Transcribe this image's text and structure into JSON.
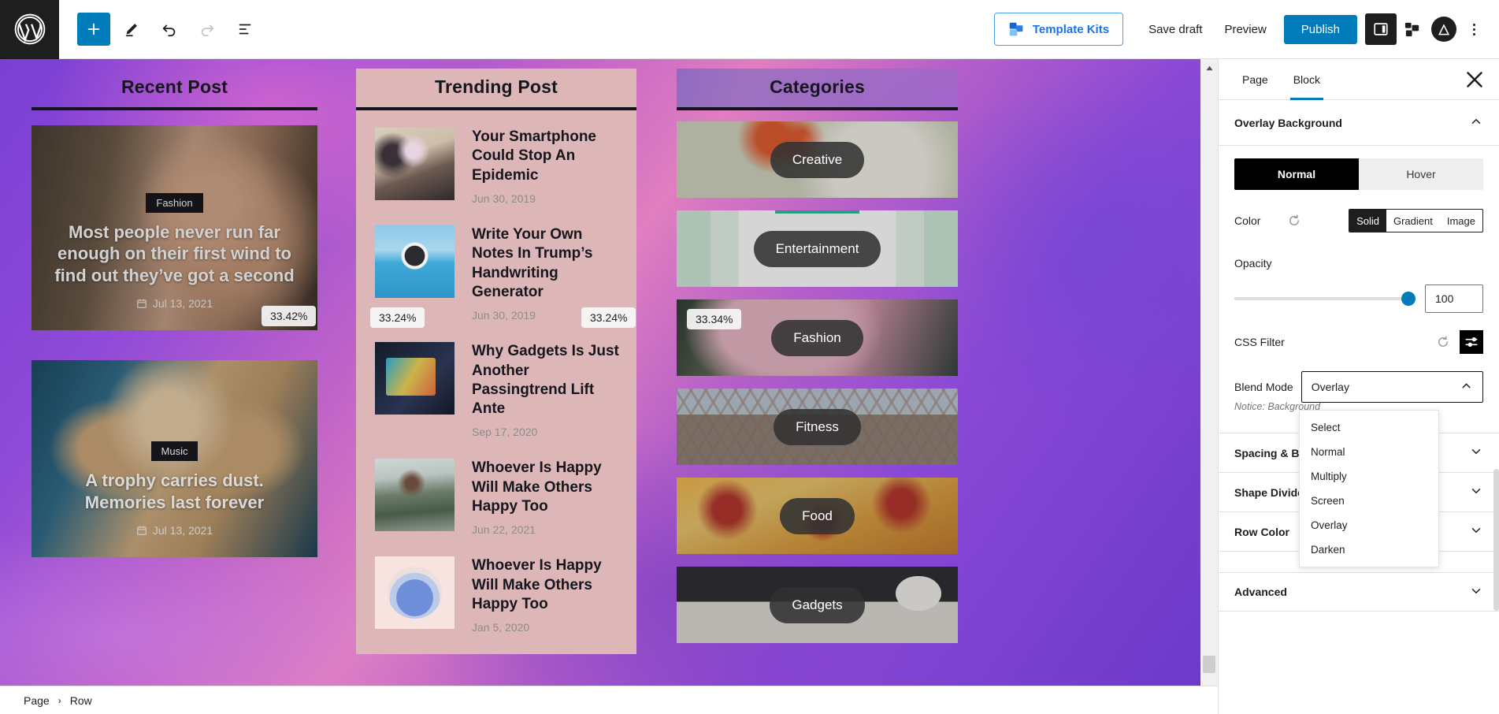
{
  "topbar": {
    "logo_icon": "wordpress-logo-icon",
    "add_block_icon": "plus-icon",
    "tools_icon": "pencil-icon",
    "undo_icon": "undo-arrow-icon",
    "redo_icon": "redo-arrow-icon",
    "list_view_icon": "list-view-icon",
    "template_kits_label": "Template Kits",
    "template_kits_icon": "template-kits-icon",
    "save_draft_label": "Save draft",
    "preview_label": "Preview",
    "publish_label": "Publish",
    "settings_icon": "sidebar-toggle-icon",
    "blocks_icon": "pattern-blocks-icon",
    "astra_icon": "astra-logo-icon",
    "more_icon": "kebab-menu-icon",
    "accent_blue": "#007cba",
    "link_blue": "#1a73e8"
  },
  "canvas": {
    "recent": {
      "title": "Recent Post",
      "posts": [
        {
          "tag": "Fashion",
          "title": "Most people never run far enough on their first wind to find out they’ve got a second",
          "date": "Jul 13, 2021",
          "date_icon": "calendar-icon"
        },
        {
          "tag": "Music",
          "title": "A trophy carries dust. Memories last forever",
          "date": "Jul 13, 2021",
          "date_icon": "calendar-icon"
        }
      ],
      "resize_badge": "33.42%"
    },
    "trending": {
      "title": "Trending Post",
      "posts": [
        {
          "title": "Your Smartphone Could Stop An Epidemic",
          "date": "Jun 30, 2019"
        },
        {
          "title": "Write Your Own Notes In Trump’s Handwriting Generator",
          "date": "Jun 30, 2019"
        },
        {
          "title": "Why Gadgets Is Just Another Passingtrend Lift Ante",
          "date": "Sep 17, 2020"
        },
        {
          "title": "Whoever Is Happy Will Make Others Happy Too",
          "date": "Jun 22, 2021"
        },
        {
          "title": "Whoever Is Happy Will Make Others Happy Too",
          "date": "Jan 5, 2020"
        }
      ],
      "resize_badge_left": "33.24%",
      "resize_badge_right": "33.24%"
    },
    "categories": {
      "title": "Categories",
      "items": [
        "Creative",
        "Entertainment",
        "Fashion",
        "Fitness",
        "Food",
        "Gadgets"
      ],
      "resize_badge": "33.34%"
    },
    "scroll_up_icon": "scroll-up-arrow-icon"
  },
  "breadcrumb": {
    "root": "Page",
    "separator": "›",
    "current": "Row"
  },
  "sidebar": {
    "tabs": [
      {
        "label": "Page",
        "active": false
      },
      {
        "label": "Block",
        "active": true
      }
    ],
    "close_icon": "close-icon",
    "panel": {
      "title": "Overlay Background",
      "collapse_icon": "chevron-up-icon",
      "state_tabs": {
        "normal": "Normal",
        "hover": "Hover"
      },
      "color": {
        "label": "Color",
        "reset_icon": "reset-icon",
        "types": [
          "Solid",
          "Gradient",
          "Image"
        ],
        "selected_type": "Solid"
      },
      "opacity": {
        "label": "Opacity",
        "value": "100"
      },
      "css_filter": {
        "label": "CSS Filter",
        "reset_icon": "reset-icon",
        "filter_icon": "sliders-icon"
      },
      "blend_mode": {
        "label": "Blend Mode",
        "value": "Overlay",
        "chevron_icon": "chevron-up-icon",
        "options": [
          "Select",
          "Normal",
          "Multiply",
          "Screen",
          "Overlay",
          "Darken"
        ]
      },
      "notice": "Notice: Background"
    },
    "sections": [
      {
        "label": "Spacing & Border",
        "chevron": "chevron-down-icon"
      },
      {
        "label": "Shape Divider",
        "chevron": "chevron-down-icon"
      },
      {
        "label": "Row Color",
        "chevron": "chevron-down-icon"
      },
      {
        "label": "Advanced",
        "chevron": "chevron-down-icon"
      }
    ]
  }
}
